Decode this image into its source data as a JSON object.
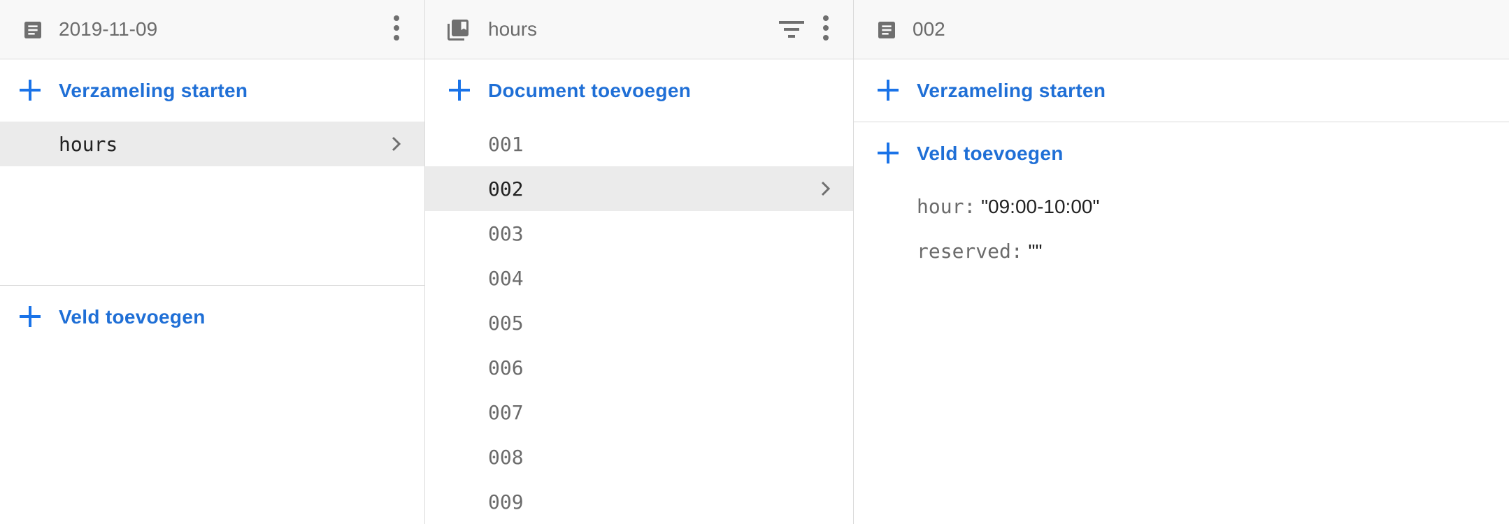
{
  "columns": {
    "root_doc": {
      "title": "2019-11-09",
      "icon": "document-icon",
      "start_collection_label": "Verzameling starten",
      "collections": [
        {
          "label": "hours",
          "selected": true
        }
      ],
      "add_field_label": "Veld toevoegen"
    },
    "collection": {
      "title": "hours",
      "icon": "collection-icon",
      "add_document_label": "Document toevoegen",
      "documents": [
        {
          "label": "001",
          "selected": false
        },
        {
          "label": "002",
          "selected": true
        },
        {
          "label": "003",
          "selected": false
        },
        {
          "label": "004",
          "selected": false
        },
        {
          "label": "005",
          "selected": false
        },
        {
          "label": "006",
          "selected": false
        },
        {
          "label": "007",
          "selected": false
        },
        {
          "label": "008",
          "selected": false
        },
        {
          "label": "009",
          "selected": false
        }
      ]
    },
    "document": {
      "title": "002",
      "icon": "document-icon",
      "start_collection_label": "Verzameling starten",
      "add_field_label": "Veld toevoegen",
      "fields": [
        {
          "key": "hour:",
          "value": "\"09:00-10:00\""
        },
        {
          "key": "reserved:",
          "value": "\"\""
        }
      ]
    }
  },
  "colors": {
    "accent": "#1a73e8",
    "selected_row": "#ebebeb",
    "header_bg": "#f8f8f8"
  }
}
